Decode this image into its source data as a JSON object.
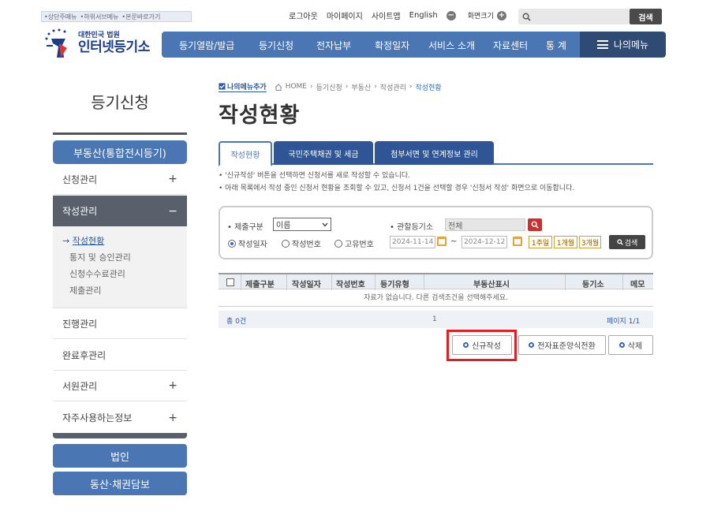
{
  "skip_links": [
    "•상단주메뉴",
    "•하위서브메뉴",
    "•본문바로가기"
  ],
  "util": {
    "logout": "로그아웃",
    "mypage": "마이페이지",
    "sitemap": "사이트맵",
    "english": "English",
    "zoom_label": "화면크기",
    "search_button": "검색"
  },
  "logo": {
    "line1": "대한민국 법원",
    "line2": "인터넷등기소"
  },
  "gnb": [
    "등기열람/발급",
    "등기신청",
    "전자납부",
    "확정일자",
    "서비스 소개",
    "자료센터",
    "통 계"
  ],
  "mymenu_label": "나의메뉴",
  "sidebar": {
    "title": "등기신청",
    "section": "부동산(통합전시등기)",
    "items": [
      {
        "label": "신청관리",
        "toggle": "+"
      },
      {
        "label": "작성관리",
        "toggle": "−"
      }
    ],
    "sub_items": [
      "작성현황",
      "통지 및 승인관리",
      "신청수수료관리",
      "제출관리"
    ],
    "items_after": [
      {
        "label": "진행관리",
        "toggle": ""
      },
      {
        "label": "완료후관리",
        "toggle": ""
      },
      {
        "label": "서원관리",
        "toggle": "+"
      },
      {
        "label": "자주사용하는정보",
        "toggle": "+"
      }
    ],
    "buttons": [
      "법인",
      "동산·채권담보"
    ]
  },
  "breadcrumb": {
    "favorite": "나의메뉴추가",
    "items": [
      "HOME",
      "등기신청",
      "부동산",
      "작성관리"
    ],
    "current": "작성현황"
  },
  "page_title": "작성현황",
  "tabs": [
    "작성현황",
    "국민주택채권 및 세금",
    "첨부서면 및 연계정보 관리"
  ],
  "notes": [
    "• '신규작성' 버튼을 선택하면 신청서를 새로 작성할 수 있습니다.",
    "• 아래 목록에서 작성 중인 신청서 현황을 조회할 수 있고, 신청서 1건을 선택할 경우 '신청서 작성' 화면으로 이동합니다."
  ],
  "filter": {
    "submit_type_label": "• 제출구분",
    "submit_type_value": "이름",
    "court_label": "• 관할등기소",
    "court_value": "전체",
    "radio_options": [
      "작성일자",
      "작성번호",
      "고유번호"
    ],
    "date_from": "2024-11-14",
    "date_to": "2024-12-12",
    "periods": [
      "1주일",
      "1개월",
      "3개월"
    ],
    "search_button": "검색"
  },
  "table": {
    "headers": [
      "제출구분",
      "작성일자",
      "작성번호",
      "등기유형",
      "부동산표시",
      "등기소",
      "메모"
    ],
    "empty_message": "자료가 없습니다. 다른 검색조건을 선택해주세요."
  },
  "pager": {
    "total": "총 0건",
    "page": "1",
    "page_info": "페이지 1/1"
  },
  "actions": [
    "신규작성",
    "전자표준양식전환",
    "삭제"
  ]
}
